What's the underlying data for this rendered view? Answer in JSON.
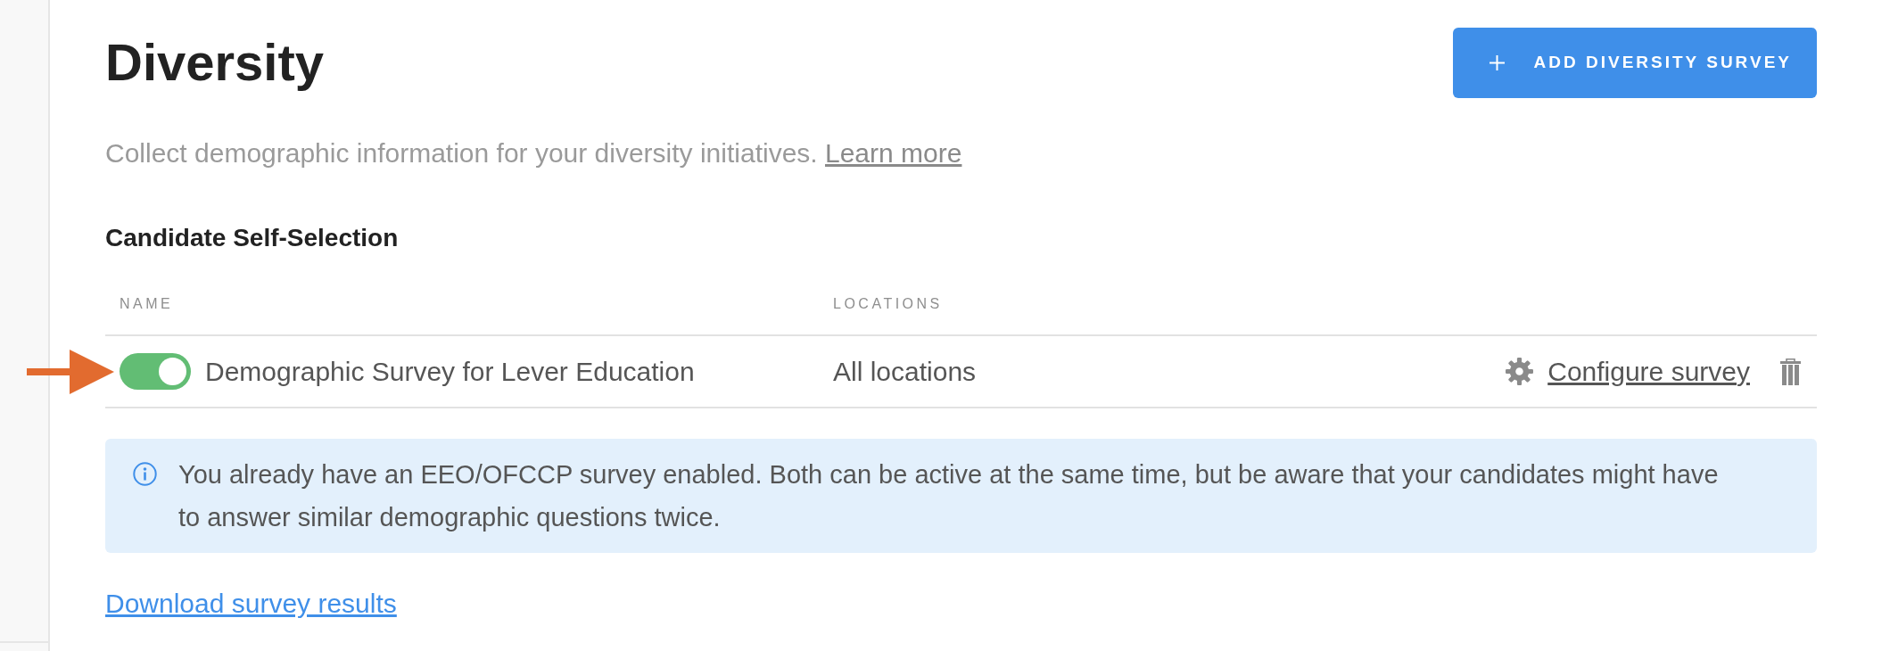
{
  "header": {
    "title": "Diversity",
    "add_button": "ADD DIVERSITY SURVEY"
  },
  "intro": {
    "text": "Collect demographic information for your diversity initiatives.",
    "link": "Learn more"
  },
  "section": {
    "title": "Candidate Self-Selection"
  },
  "table": {
    "columns": [
      "NAME",
      "LOCATIONS"
    ],
    "rows": [
      {
        "name": "Demographic Survey for Lever Education",
        "enabled": true,
        "locations": "All locations",
        "action_link": "Configure survey"
      }
    ]
  },
  "notice": {
    "text": "You already have an EEO/OFCCP survey enabled. Both can be active at the same time, but be aware that your candidates might have to answer similar demographic questions twice."
  },
  "download_link": "Download survey results"
}
